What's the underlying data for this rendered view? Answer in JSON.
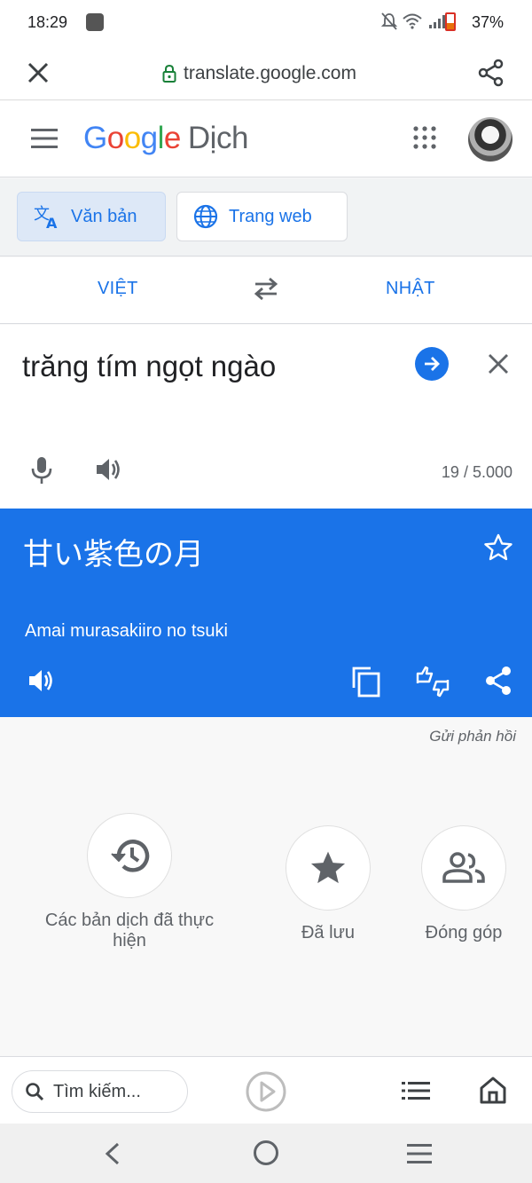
{
  "status_bar": {
    "time": "18:29",
    "battery": "37%"
  },
  "browser": {
    "url": "translate.google.com"
  },
  "app": {
    "logo_letters": [
      "G",
      "o",
      "o",
      "g",
      "l",
      "e"
    ],
    "product": "Dịch"
  },
  "modes": {
    "text": "Văn bản",
    "web": "Trang web"
  },
  "languages": {
    "source": "VIỆT",
    "target": "NHẬT"
  },
  "input": {
    "text": "trăng tím ngọt ngào",
    "char_count": "19 / 5.000"
  },
  "output": {
    "translation": "甘い紫色の月",
    "romanization": "Amai murasakiiro no tsuki"
  },
  "feedback_label": "Gửi phản hồi",
  "quick_actions": {
    "history": "Các bản dịch đã thực hiện",
    "saved": "Đã lưu",
    "contribute": "Đóng góp"
  },
  "browser_bottom": {
    "search_placeholder": "Tìm kiếm..."
  },
  "colors": {
    "accent": "#1a73e8",
    "output_bg": "#1a73e8"
  }
}
